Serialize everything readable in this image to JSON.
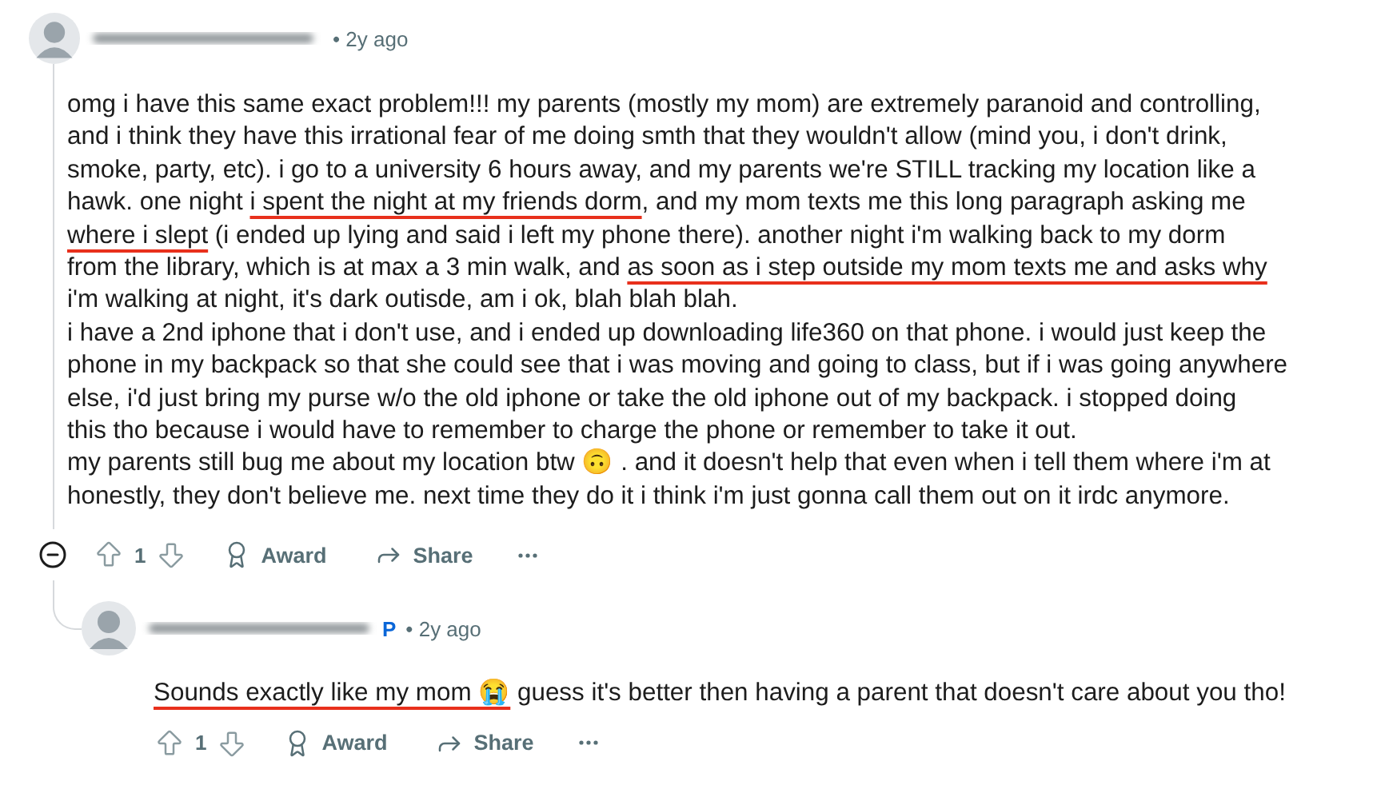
{
  "comment": {
    "time": "• 2y ago",
    "collapsed": false,
    "paragraphs": [
      {
        "lines": [
          [
            {
              "text": "omg i have this same exact problem!!! my parents (mostly my mom) are extremely paranoid and controlling,",
              "underlined": false
            }
          ],
          [
            {
              "text": "and i think they have this irrational fear of me doing smth that they wouldn't allow (mind you, i don't drink,",
              "underlined": false
            }
          ],
          [
            {
              "text": "smoke, party, etc). i go to a university 6 hours away, and my parents we're STILL tracking my location like a",
              "underlined": false
            }
          ],
          [
            {
              "text": "hawk. one night ",
              "underlined": false
            },
            {
              "text": "i spent the night at my friends dorm",
              "underlined": true
            },
            {
              "text": ", and my mom texts me this long paragraph asking me",
              "underlined": false
            }
          ],
          [
            {
              "text": "where i slept",
              "underlined": true
            },
            {
              "text": " (i ended up lying and said i left my phone there). another night i'm walking back to my dorm",
              "underlined": false
            }
          ],
          [
            {
              "text": "from the library, which is at max a 3 min walk, and ",
              "underlined": false
            },
            {
              "text": "as soon as i step outside my mom texts me and asks why",
              "underlined": true
            }
          ],
          [
            {
              "text": "i'm walking at night, it's dark outisde, am i ok, blah blah blah.",
              "underlined": false
            }
          ]
        ]
      },
      {
        "lines": [
          [
            {
              "text": "i have a 2nd iphone that i don't use, and i ended up downloading life360 on that phone. i would just keep the",
              "underlined": false
            }
          ],
          [
            {
              "text": "phone in my backpack so that she could see that i was moving and going to class, but if i was going anywhere",
              "underlined": false
            }
          ],
          [
            {
              "text": "else, i'd just bring my purse w/o the old iphone or take the old iphone out of my backpack. i stopped doing",
              "underlined": false
            }
          ],
          [
            {
              "text": "this tho because i would have to remember to charge the phone or remember to take it out.",
              "underlined": false
            }
          ]
        ]
      },
      {
        "lines": [
          [
            {
              "text": "my parents still bug me about my location btw 🙃 . and it doesn't help that even when i tell them where i'm at",
              "underlined": false
            }
          ],
          [
            {
              "text": "honestly, they don't believe me. next time they do it i think i'm just gonna call them out on it irdc anymore.",
              "underlined": false
            }
          ]
        ]
      }
    ],
    "votes": "1",
    "actions": [
      "Award",
      "Share"
    ]
  },
  "reply": {
    "op_badge": "P",
    "time": "• 2y ago",
    "paragraphs": [
      {
        "lines": [
          [
            {
              "text": "Sounds exactly like my mom 😭",
              "underlined": true
            },
            {
              "text": " guess it's better then having a parent that doesn't care about you tho!",
              "underlined": false
            }
          ]
        ]
      }
    ],
    "votes": "1",
    "actions": [
      "Award",
      "Share"
    ]
  }
}
